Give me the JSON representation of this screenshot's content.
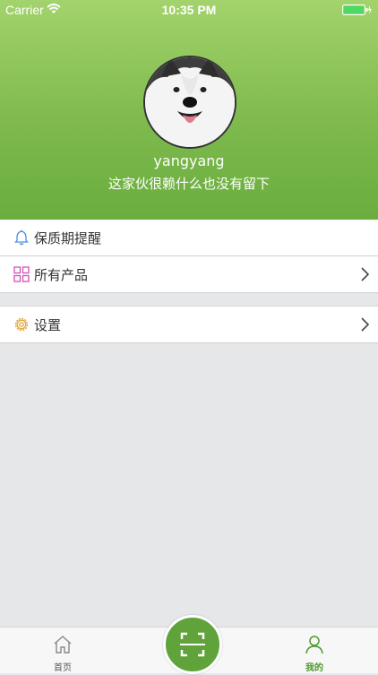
{
  "status": {
    "carrier": "Carrier",
    "time": "10:35 PM"
  },
  "profile": {
    "username": "yangyang",
    "bio": "这家伙很赖什么也没有留下"
  },
  "menu": {
    "reminder_label": "保质期提醒",
    "products_label": "所有产品",
    "settings_label": "设置"
  },
  "tabs": {
    "home_label": "首页",
    "mine_label": "我的"
  },
  "colors": {
    "accent": "#6aad3e",
    "active_tab": "#4c9a2a",
    "inactive_tab": "#888888"
  }
}
